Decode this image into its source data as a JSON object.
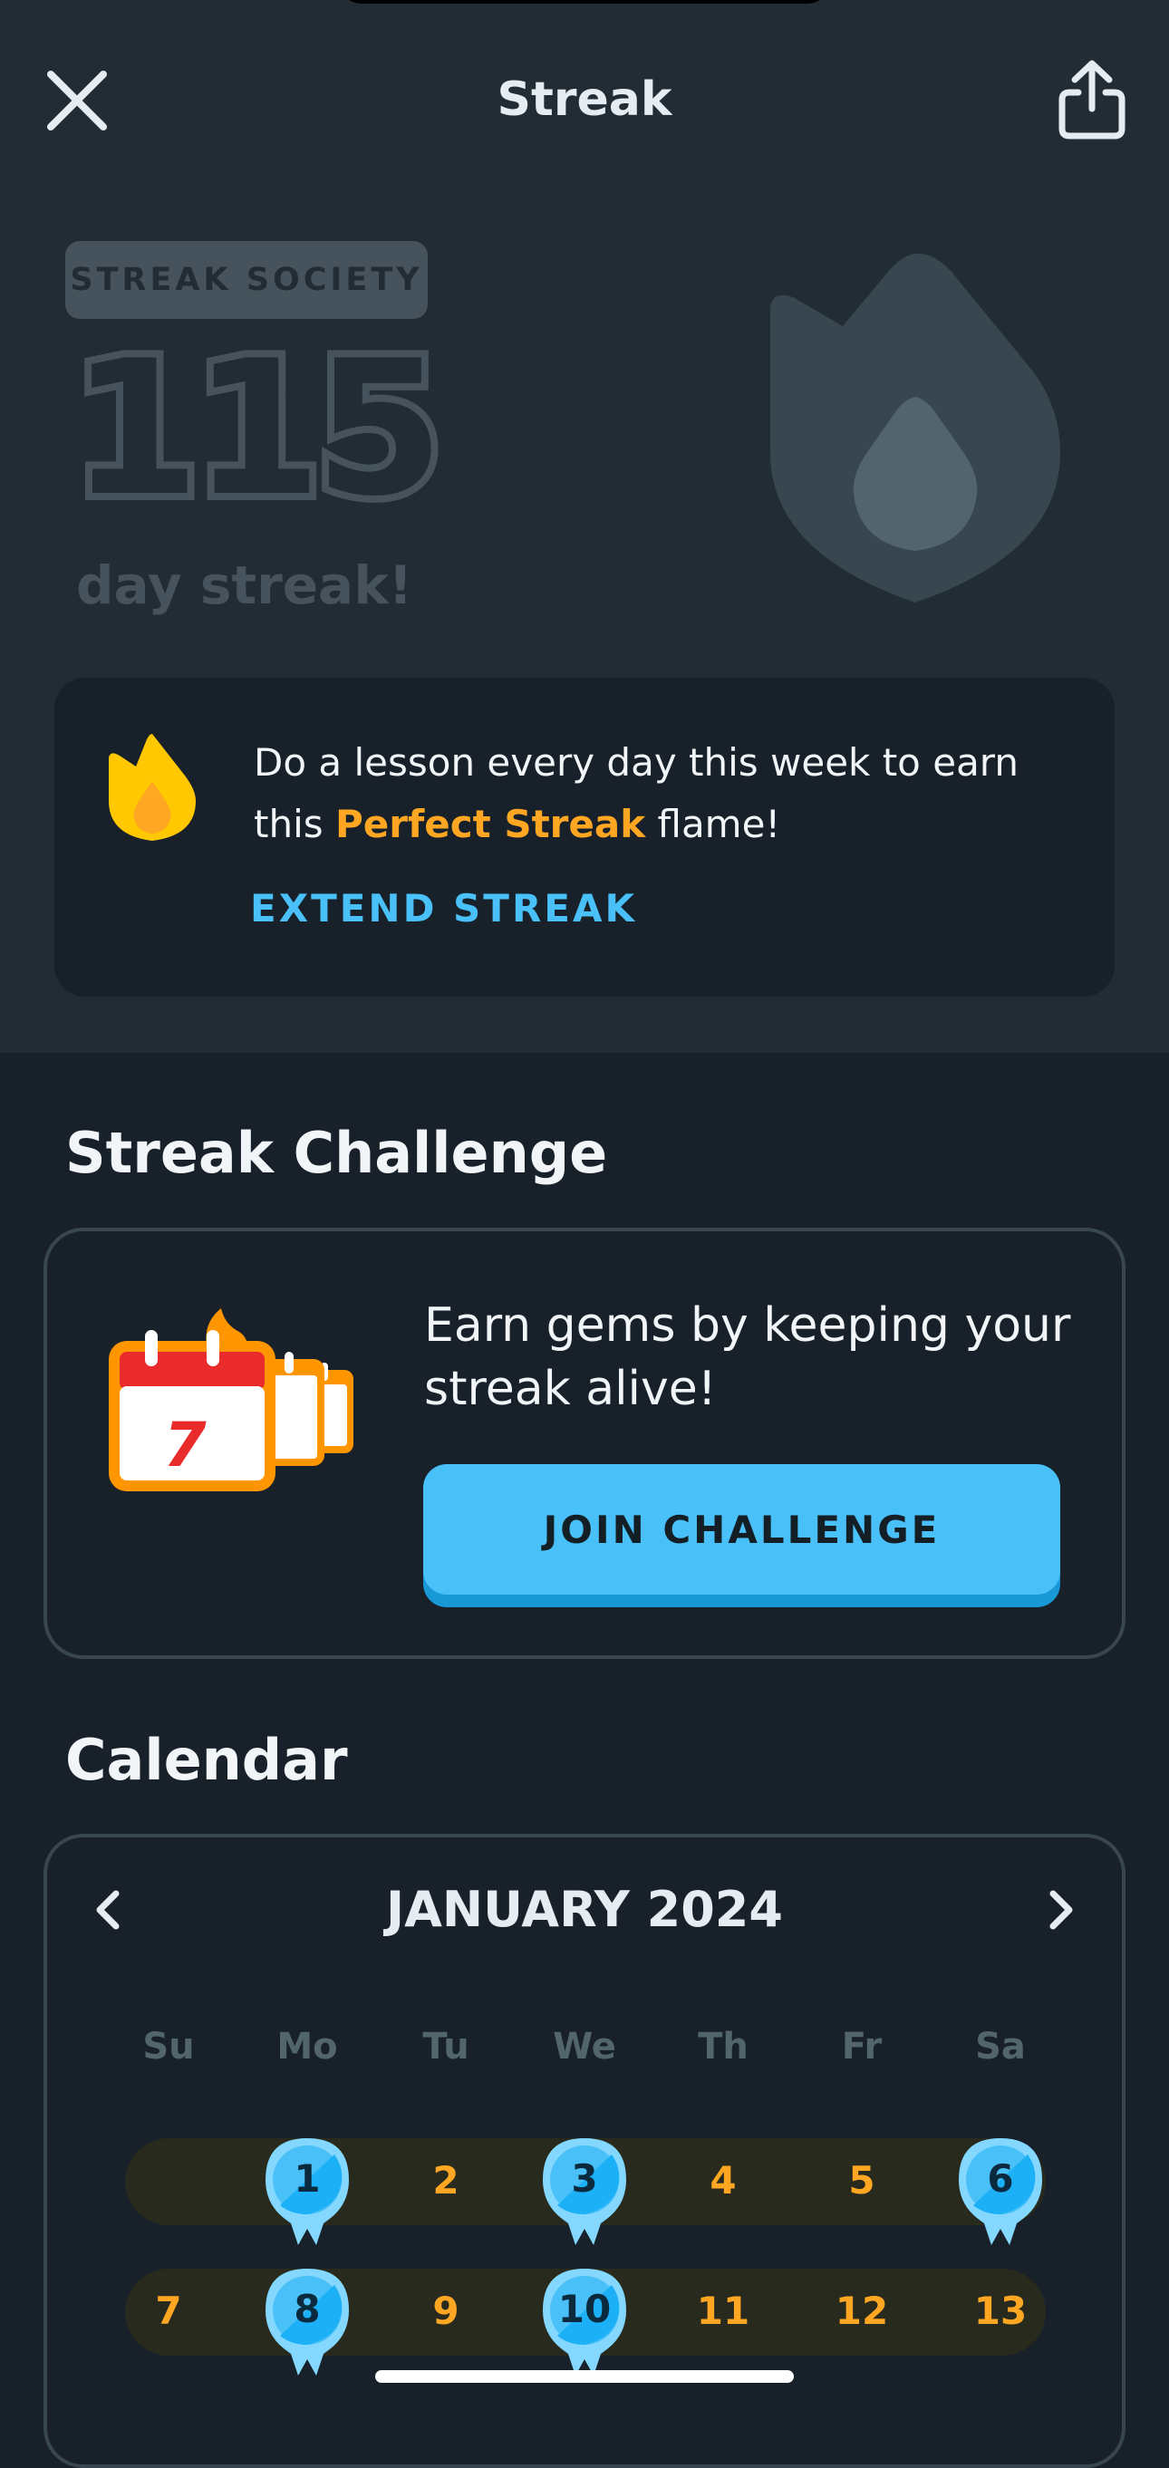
{
  "header": {
    "title": "Streak"
  },
  "hero": {
    "badge": "STREAK SOCIETY",
    "count": "115",
    "label": "day streak!"
  },
  "perfect_streak": {
    "text_before": "Do a lesson every day this week to earn this ",
    "highlight": "Perfect Streak",
    "text_after": " flame!",
    "link": "EXTEND STREAK"
  },
  "challenge": {
    "section_title": "Streak Challenge",
    "calendar_icon_day": "7",
    "text": "Earn gems by keeping your streak alive!",
    "button": "JOIN CHALLENGE"
  },
  "calendar": {
    "section_title": "Calendar",
    "month": "JANUARY 2024",
    "weekdays": [
      "Su",
      "Mo",
      "Tu",
      "We",
      "Th",
      "Fr",
      "Sa"
    ],
    "weeks": [
      [
        {
          "d": ""
        },
        {
          "d": "1",
          "frozen": true
        },
        {
          "d": "2"
        },
        {
          "d": "3",
          "frozen": true
        },
        {
          "d": "4"
        },
        {
          "d": "5"
        },
        {
          "d": "6",
          "frozen": true
        }
      ],
      [
        {
          "d": "7"
        },
        {
          "d": "8",
          "frozen": true
        },
        {
          "d": "9"
        },
        {
          "d": "10",
          "frozen": true
        },
        {
          "d": "11"
        },
        {
          "d": "12"
        },
        {
          "d": "13"
        }
      ]
    ]
  },
  "colors": {
    "background": "#18202a",
    "hero_background": "#212c35",
    "accent_blue": "#49c0f8",
    "accent_orange": "#ffa722",
    "muted": "#46535c"
  },
  "icons": [
    "close-icon",
    "share-icon",
    "flame-icon",
    "calendar-icon",
    "chevron-left-icon",
    "chevron-right-icon",
    "streak-freeze-icon"
  ]
}
